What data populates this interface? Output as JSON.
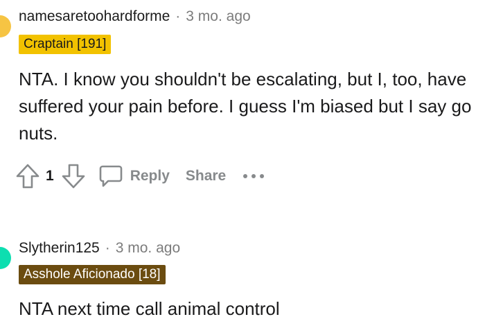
{
  "comments": [
    {
      "username": "namesaretoohardforme",
      "separator": "·",
      "time": "3 mo. ago",
      "flair": "Craptain [191]",
      "flair_color": "#f2c200",
      "avatar_color": "#f6c443",
      "body": "NTA. I know you shouldn't be escalating, but I, too, have suffered your pain before. I guess I'm biased but I say go nuts.",
      "actions": {
        "upvote_icon": "upvote-arrow-icon",
        "vote_count": "1",
        "downvote_icon": "downvote-arrow-icon",
        "reply_icon": "speech-bubble-icon",
        "reply_label": "Reply",
        "share_label": "Share",
        "more_icon": "ellipsis-icon"
      }
    },
    {
      "username": "Slytherin125",
      "separator": "·",
      "time": "3 mo. ago",
      "flair": "Asshole Aficionado [18]",
      "flair_color": "#6b4c10",
      "avatar_color": "#0ddeb0",
      "body": "NTA next time call animal control"
    }
  ]
}
